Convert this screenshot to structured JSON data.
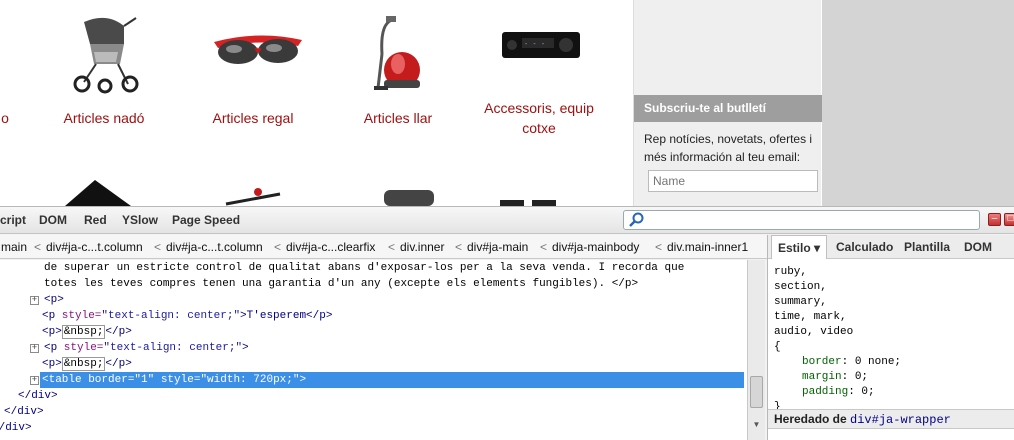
{
  "page": {
    "products": [
      {
        "label": "o",
        "image": "partial-item"
      },
      {
        "label": "Articles nadó",
        "image": "stroller-icon"
      },
      {
        "label": "Articles regal",
        "image": "sunglasses-icon"
      },
      {
        "label": "Articles llar",
        "image": "vacuum-cleaner-icon"
      },
      {
        "label_line1": "Accessoris, equip",
        "label_line2": "cotxe",
        "image": "car-stereo-icon"
      }
    ],
    "sidebar": {
      "heading": "Subscriu-te al butlletí",
      "text": "Rep notícies, novetats, ofertes i més información al teu email:",
      "name_placeholder": "Name"
    }
  },
  "firebug": {
    "tabs": [
      "cript",
      "DOM",
      "Red",
      "YSlow",
      "Page Speed"
    ],
    "search_value": "",
    "breadcrumbs": [
      "main",
      "div#ja-c...t.column",
      "div#ja-c...t.column",
      "div#ja-c...clearfix",
      "div.inner",
      "div#ja-main",
      "div#ja-mainbody",
      "div.main-inner1"
    ],
    "html_lines": [
      {
        "text": "de superar un estricte control de qualitat abans d'exposar-los per a la seva venda. I recorda que"
      },
      {
        "text": "totes les teves compres tenen una garantia d'un any (excepte els elements fungibles). </p>"
      },
      {
        "open": "<p>"
      },
      {
        "tag1": "<p",
        "attr": " style=",
        "val": "\"text-align: center;\"",
        "rest": ">T'esperem</p>"
      },
      {
        "tag1": "<p>",
        "nbsp": "&nbsp;",
        "rest": "</p>"
      },
      {
        "tag1": "<p",
        "attr": " style=",
        "val": "\"text-align: center;\"",
        "rest": ">"
      },
      {
        "tag1": "<p>",
        "nbsp": "&nbsp;",
        "rest": "</p>"
      },
      {
        "tag1": "<table",
        "attr1": " border=",
        "val1": "\"1\"",
        "attr2": " style=",
        "val2": "\"width: 720px;\"",
        "rest": ">"
      },
      {
        "text": "</div>"
      },
      {
        "text": "</div>"
      },
      {
        "text": "</div>"
      }
    ],
    "side_tabs": [
      "Estilo ▾",
      "Calculado",
      "Plantilla",
      "DOM"
    ],
    "css_lines": [
      "ruby,",
      "section,",
      "summary,",
      "time, mark,",
      "audio, video",
      "{"
    ],
    "css_props": [
      {
        "prop": "border",
        "value": "0 none;"
      },
      {
        "prop": "margin",
        "value": "0;"
      },
      {
        "prop": "padding",
        "value": "0;"
      }
    ],
    "css_close": "}",
    "inherit_label": "Heredado de",
    "inherit_link": "div#ja-wrapper"
  }
}
